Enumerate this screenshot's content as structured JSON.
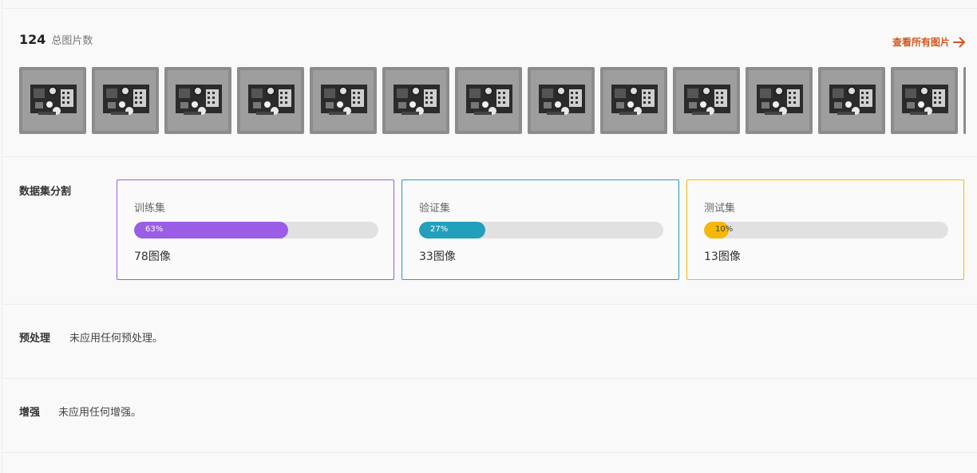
{
  "summary": {
    "total_count": "124",
    "total_label": "总图片数",
    "view_all_label": "查看所有图片"
  },
  "thumbnails": {
    "count": 13,
    "partial_extra": true
  },
  "split": {
    "label": "数据集分割",
    "cards": [
      {
        "title": "训练集",
        "percent": 63,
        "percent_label": "63%",
        "count_label": "78图像",
        "color": "#9b5de5"
      },
      {
        "title": "验证集",
        "percent": 27,
        "percent_label": "27%",
        "count_label": "33图像",
        "color": "#229fbb"
      },
      {
        "title": "测试集",
        "percent": 10,
        "percent_label": "10%",
        "count_label": "13图像",
        "color": "#f5b70a"
      }
    ]
  },
  "preprocessing": {
    "label": "预处理",
    "value": "未应用任何预处理。"
  },
  "augmentation": {
    "label": "增强",
    "value": "未应用任何增强。"
  },
  "colors": {
    "accent": "#d4561d",
    "divider": "#ececec",
    "bar_track": "#e1e1e1"
  }
}
